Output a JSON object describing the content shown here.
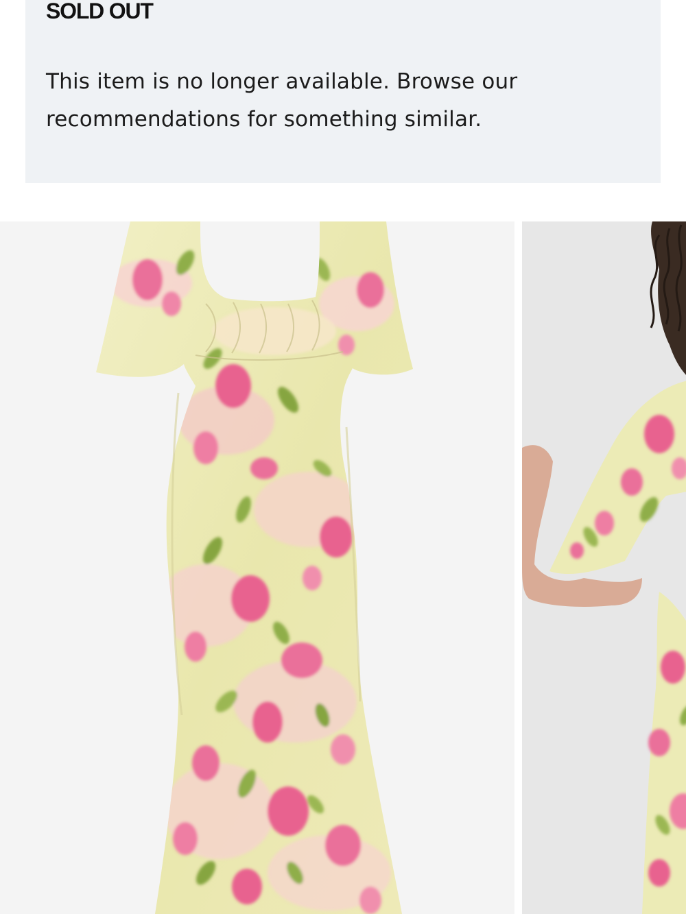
{
  "notice": {
    "title": "SOLD OUT",
    "message": "This item is no longer available. Browse our recommendations for something similar."
  },
  "gallery": {
    "images": [
      {
        "name": "dress-flat-view",
        "background": "#f4f4f4"
      },
      {
        "name": "dress-model-view",
        "background": "#e9e9e9"
      }
    ]
  },
  "colors": {
    "notice_bg": "#eff2f5",
    "text": "#121212",
    "dress_base": "#ecebb6",
    "print_pink": "#ea6f9a",
    "print_green": "#8fae48",
    "print_blush": "#f5c8cc"
  }
}
